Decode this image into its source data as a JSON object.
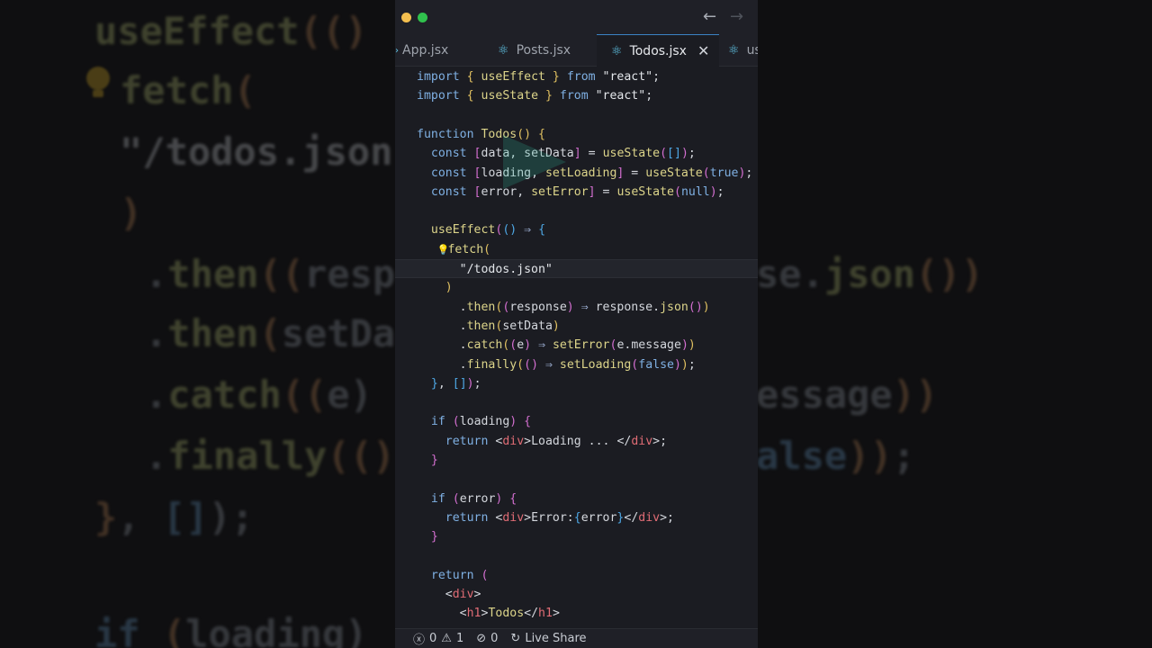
{
  "window": {
    "nav_back": "←",
    "nav_forward": "→"
  },
  "tabs": [
    {
      "label": "App.jsx",
      "active": false
    },
    {
      "label": "Posts.jsx",
      "active": false
    },
    {
      "label": "Todos.jsx",
      "active": true
    },
    {
      "label": "us",
      "active": false
    }
  ],
  "tab_close": "✕",
  "code_lines": [
    "import { useEffect } from \"react\";",
    "import { useState } from \"react\";",
    "",
    "function Todos() {",
    "  const [data, setData] = useState([]);",
    "  const [loading, setLoading] = useState(true);",
    "  const [error, setError] = useState(null);",
    "",
    "  useEffect(() => {",
    "    fetch(",
    "      \"/todos.json\"",
    "    )",
    "      .then((response) => response.json())",
    "      .then(setData)",
    "      .catch((e) => setError(e.message))",
    "      .finally(() => setLoading(false));",
    "  }, []);",
    "",
    "  if (loading) {",
    "    return <div>Loading ... </div>;",
    "  }",
    "",
    "  if (error) {",
    "    return <div>Error:{error}</div>;",
    "  }",
    "",
    "  return (",
    "    <div>",
    "      <h1>Todos</h1>"
  ],
  "status": {
    "errors": "0",
    "warnings": "1",
    "ports": "0",
    "live_share": "Live Share"
  },
  "colors": {
    "editor_bg": "#1b1c22",
    "keyword": "#7fb0e3",
    "function": "#dcd48a",
    "jsx_tag": "#e06c75",
    "accent": "#3b82c4"
  }
}
